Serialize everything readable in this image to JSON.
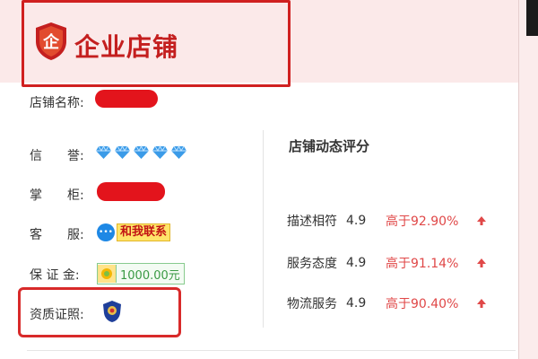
{
  "header": {
    "title": "企业店铺",
    "shield_glyph": "企"
  },
  "shop": {
    "name_label": "店铺名称:",
    "credit_label": "信　　誉:",
    "credit_diamonds": 5,
    "owner_label": "掌　　柜:",
    "service_label": "客　　服:",
    "contact_button": "和我联系",
    "deposit_label": "保 证 金:",
    "deposit_value": "1000.00元",
    "qualification_label": "资质证照:"
  },
  "ratings": {
    "title": "店铺动态评分",
    "rows": [
      {
        "label": "描述相符",
        "score": "4.9",
        "compare": "高于92.90%"
      },
      {
        "label": "服务态度",
        "score": "4.9",
        "compare": "高于91.14%"
      },
      {
        "label": "物流服务",
        "score": "4.9",
        "compare": "高于90.40%"
      }
    ]
  },
  "colors": {
    "brand_red": "#c41f1f",
    "annotation_red": "#d02020",
    "diamond_blue": "#3b9be8",
    "bond_green": "#3a9a44",
    "up_arrow": "#e04848"
  },
  "icons": [
    "shield-icon",
    "diamond-icon",
    "chat-icon",
    "deposit-icon",
    "police-badge-icon",
    "up-arrow-icon"
  ]
}
